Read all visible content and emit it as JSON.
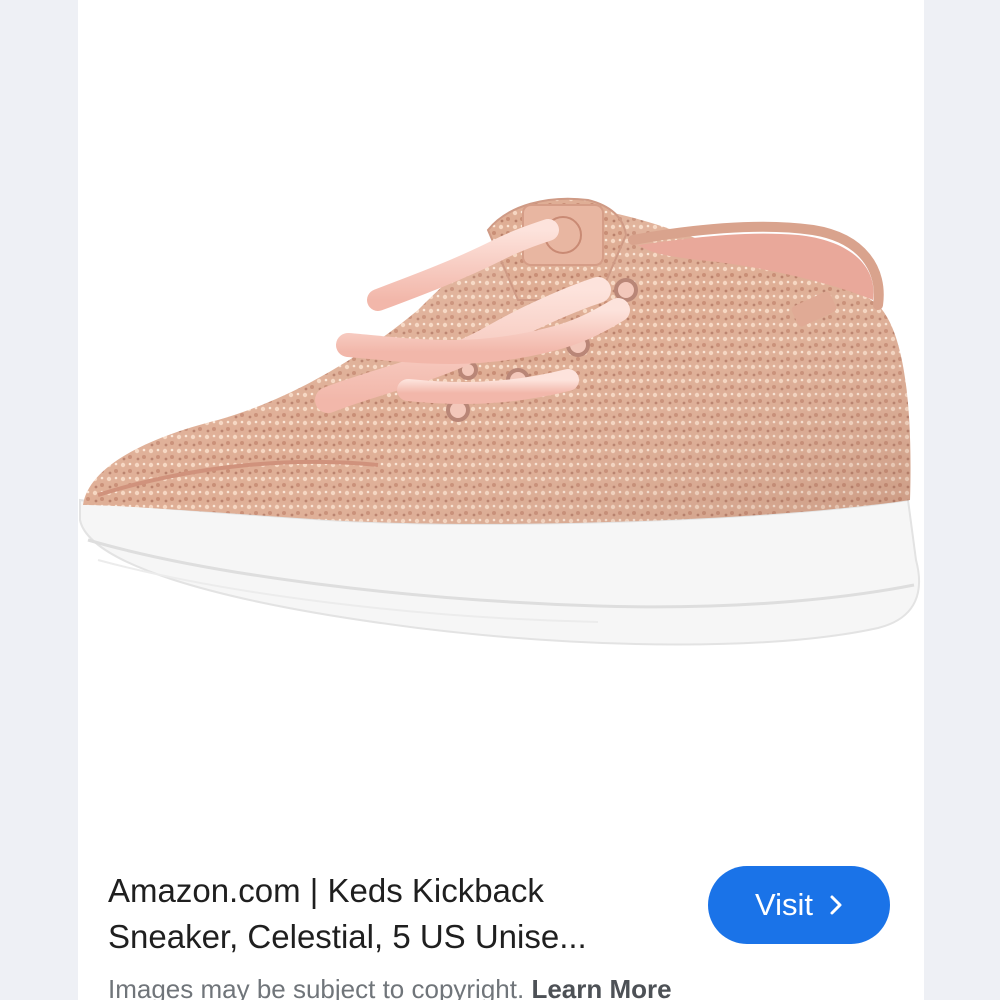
{
  "result": {
    "title_line1": "Amazon.com | Keds Kickback",
    "title_line2": "Sneaker, Celestial, 5 US Unise...",
    "image_alt": "Keds Kickback Sneaker, Celestial"
  },
  "visit_button": {
    "label": "Visit",
    "icon": "chevron-right-icon"
  },
  "copyright": {
    "text": "Images may be subject to copyright.",
    "link_label": "Learn More"
  },
  "colors": {
    "accent": "#1a73e8",
    "shoe_body": "#e3b7a0",
    "laces": "#f7c9c0",
    "sole": "#f7f7f7"
  }
}
